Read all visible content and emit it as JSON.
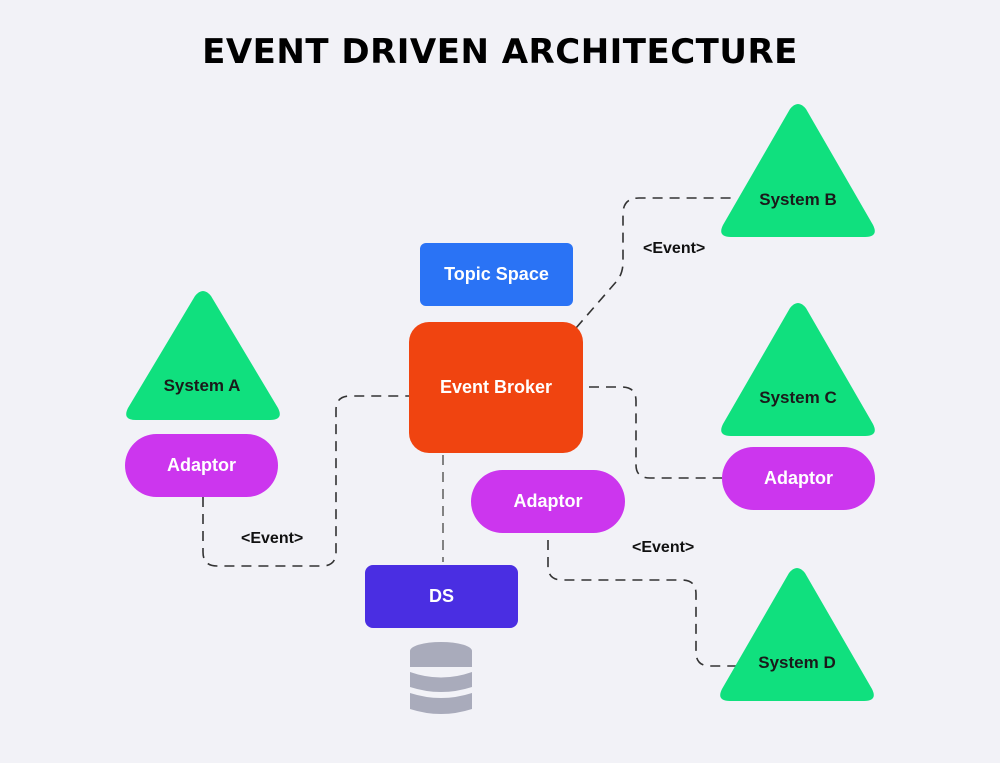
{
  "title": "EVENT DRIVEN ARCHITECTURE",
  "colors": {
    "background": "#f2f2f7",
    "topic_space": "#2a73f5",
    "event_broker": "#f04410",
    "data_store": "#4a2ee2",
    "adaptor": "#cc36ee",
    "system": "#10e07e",
    "database_icon": "#a9abbb"
  },
  "nodes": {
    "topic_space": "Topic Space",
    "event_broker": "Event Broker",
    "data_store": "DS",
    "adaptor_a": "Adaptor",
    "adaptor_broker": "Adaptor",
    "adaptor_c": "Adaptor",
    "system_a": "System A",
    "system_b": "System B",
    "system_c": "System C",
    "system_d": "System D"
  },
  "edge_labels": {
    "a_to_broker": "<Event>",
    "broker_to_b": "<Event>",
    "adaptor_to_d": "<Event>"
  },
  "icons": {
    "database": "database-icon"
  }
}
